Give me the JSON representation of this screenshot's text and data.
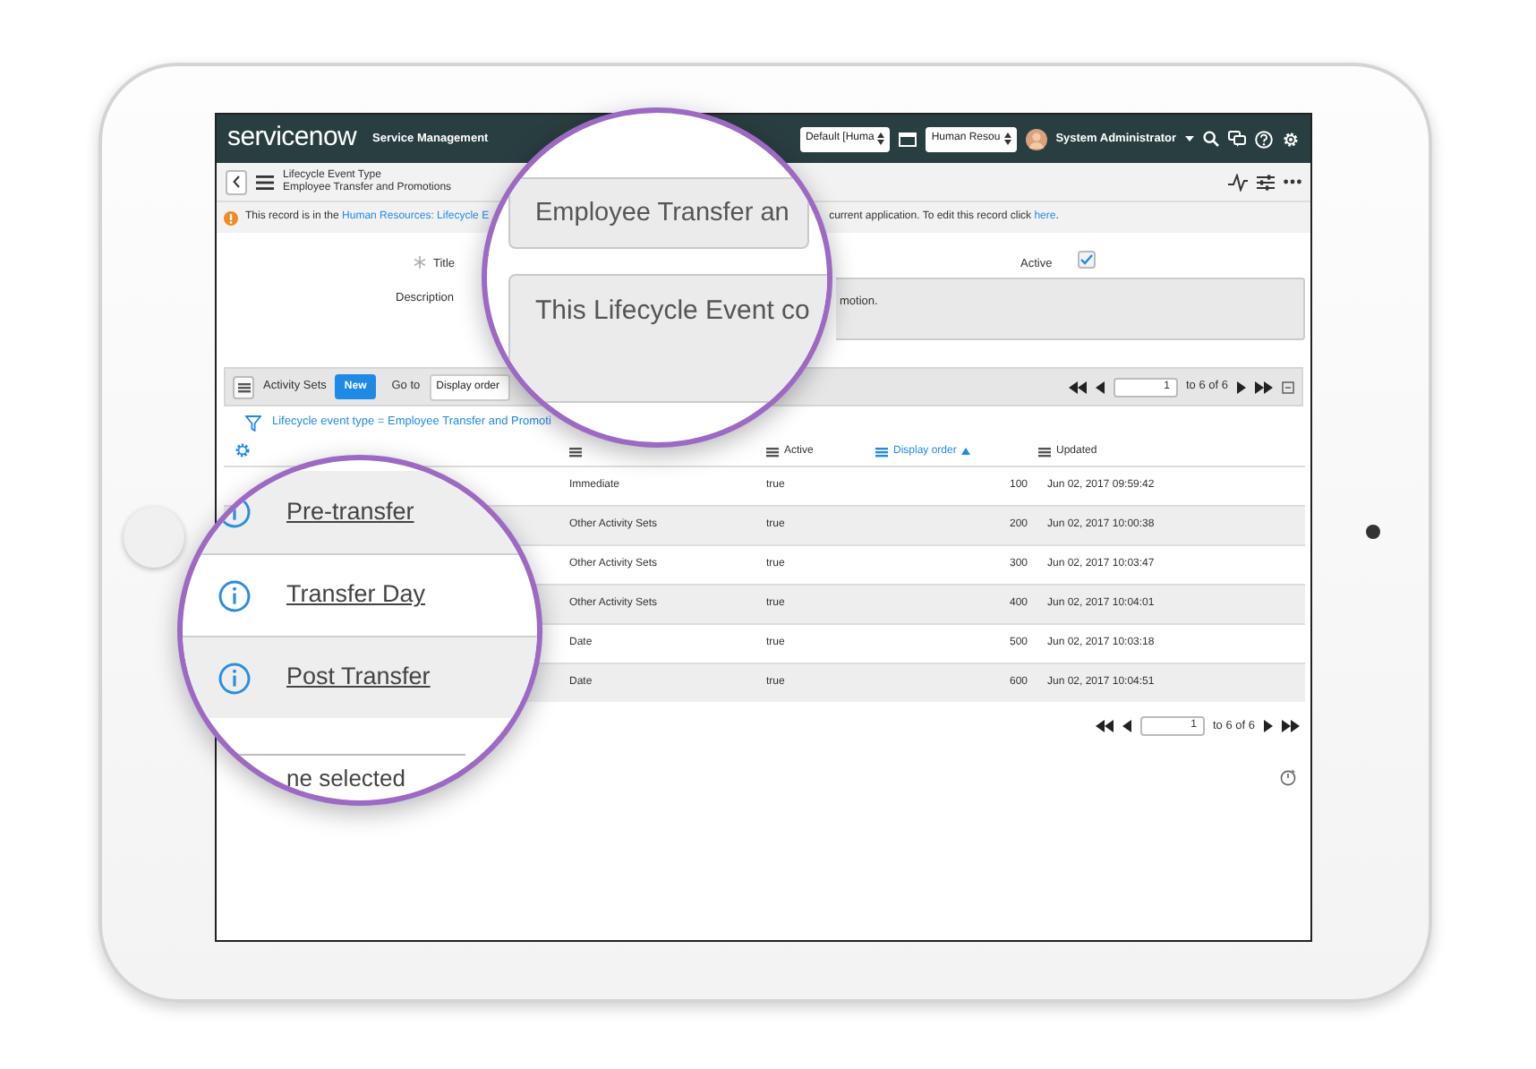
{
  "header": {
    "logo": "servicenow",
    "product": "Service Management",
    "selects": [
      "Default [Huma",
      "Human Resou"
    ],
    "user": "System Administrator"
  },
  "title_bar": {
    "record_type": "Lifecycle Event Type",
    "record_name": "Employee Transfer and Promotions"
  },
  "notice": {
    "left": {
      "text": "This record is in the ",
      "link": "Human Resources: Lifecycle E"
    },
    "right": {
      "text": "current application. To edit this record click ",
      "link": "here",
      "after": "."
    }
  },
  "form": {
    "title_label": "Title",
    "required": true,
    "active_label": "Active",
    "active": true,
    "description_label": "Description",
    "description_visible": "motion."
  },
  "related_list": {
    "title": "Activity Sets",
    "new_button": "New",
    "goto_label": "Go to",
    "goto_select": "Display order",
    "pager": {
      "page": "1",
      "range": "to 6 of 6"
    }
  },
  "filter": "Lifecycle event type = Employee Transfer and Promoti",
  "table": {
    "columns": [
      {
        "sorted": false
      },
      {
        "label": "Active",
        "sorted": false
      },
      {
        "label": "Display order",
        "sorted": true
      },
      {
        "label": "Updated",
        "sorted": false
      }
    ],
    "rows": [
      {
        "cells": [
          "Immediate",
          "true",
          "100",
          "Jun 02, 2017 09:59:42"
        ]
      },
      {
        "cells": [
          "Other Activity Sets",
          "true",
          "200",
          "Jun 02, 2017 10:00:38"
        ]
      },
      {
        "cells": [
          "Other Activity Sets",
          "true",
          "300",
          "Jun 02, 2017 10:03:47"
        ]
      },
      {
        "cells": [
          "Other Activity Sets",
          "true",
          "400",
          "Jun 02, 2017 10:04:01"
        ]
      },
      {
        "cells": [
          "Date",
          "true",
          "500",
          "Jun 02, 2017 10:03:18"
        ]
      },
      {
        "cells": [
          "Date",
          "true",
          "600",
          "Jun 02, 2017 10:04:51"
        ]
      }
    ]
  },
  "bottom_pager": {
    "page": "1",
    "range": "to 6 of 6"
  },
  "magnifier_form": {
    "title_value": "Employee Transfer an",
    "description_value": "This Lifecycle Event co"
  },
  "magnifier_rows": {
    "rows": [
      {
        "name": "Pre-transfer"
      },
      {
        "name": "Transfer Day"
      },
      {
        "name": "Post Transfer"
      }
    ],
    "footer": "ne selected"
  }
}
